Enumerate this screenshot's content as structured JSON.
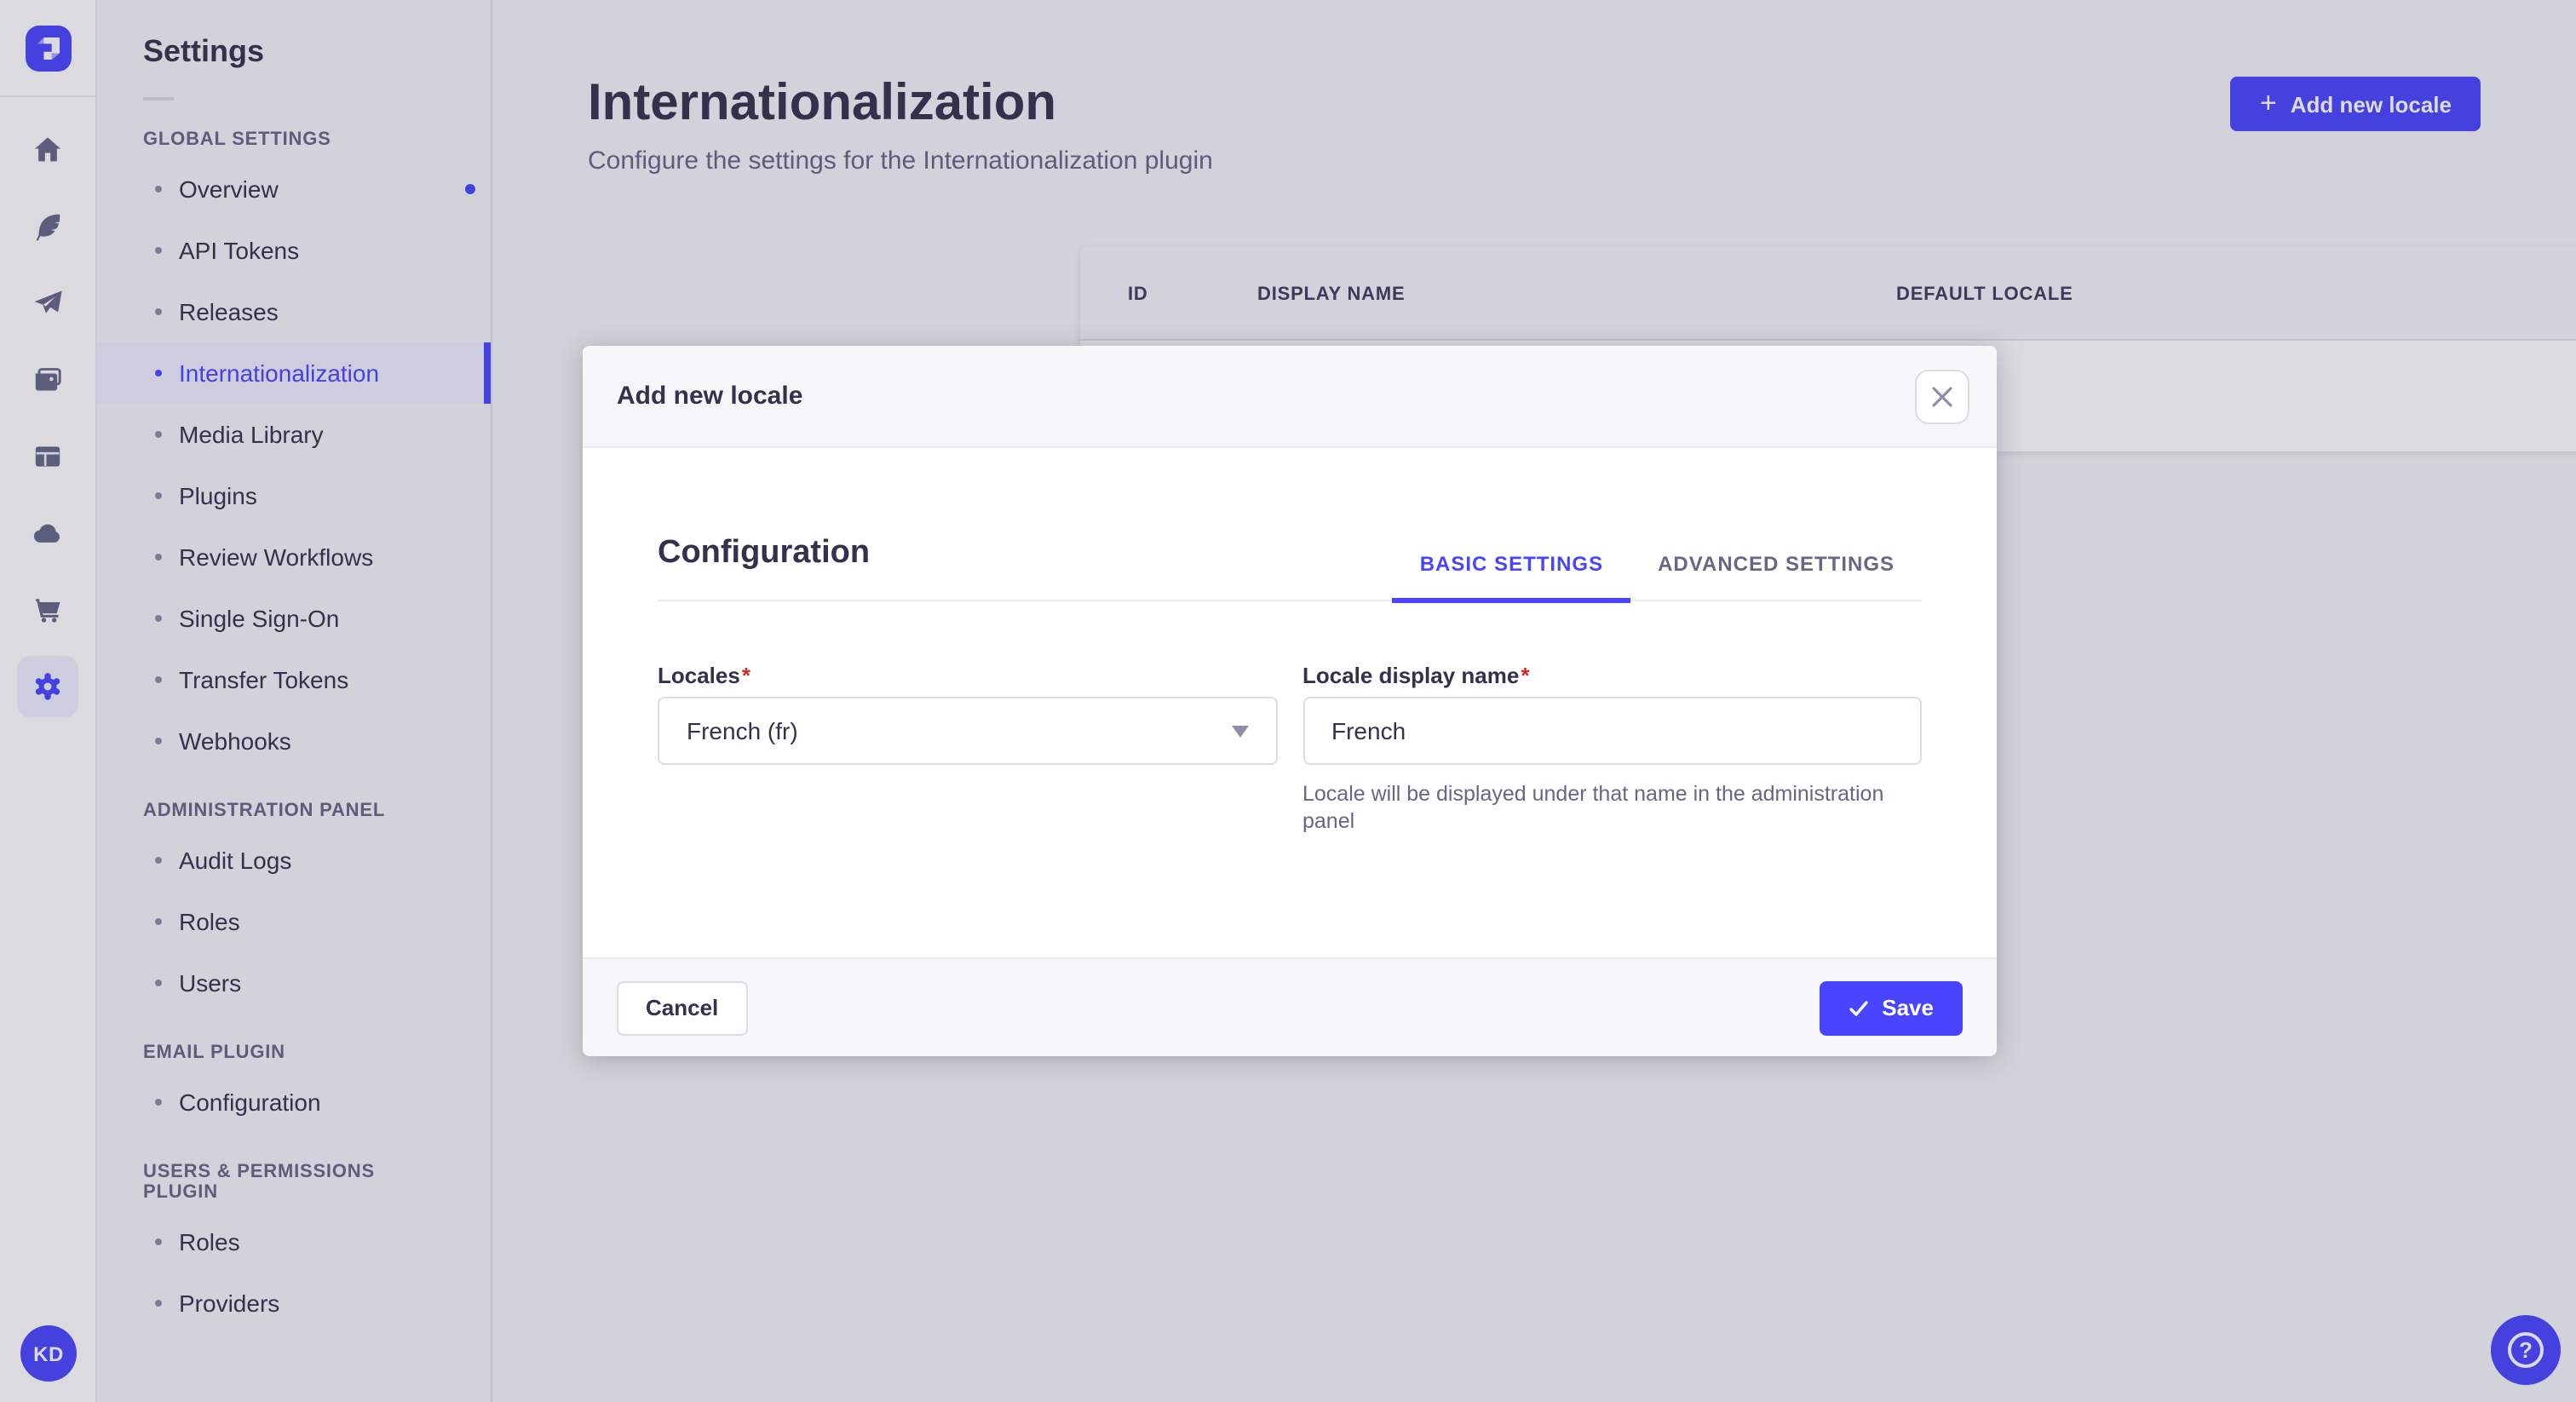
{
  "colors": {
    "accent": "#4945ff",
    "accent_soft": "#f0f0ff",
    "text_dark": "#32324d",
    "text_muted": "#666687",
    "border": "#dcdce4",
    "surface": "#ffffff",
    "surface_alt": "#f6f6f9",
    "required_red": "#d02b20"
  },
  "rail": {
    "logo_icon": "strapi-logo",
    "icons": [
      "home-icon",
      "feather-icon",
      "paper-plane-icon",
      "media-library-icon",
      "layout-icon",
      "cloud-icon",
      "cart-icon",
      "settings-gear-icon"
    ],
    "active_icon": "settings-gear-icon",
    "avatar_initials": "KD"
  },
  "sidebar": {
    "title": "Settings",
    "sections": [
      {
        "label": "GLOBAL SETTINGS",
        "items": [
          {
            "label": "Overview",
            "notification": true
          },
          {
            "label": "API Tokens"
          },
          {
            "label": "Releases"
          },
          {
            "label": "Internationalization",
            "active": true
          },
          {
            "label": "Media Library"
          },
          {
            "label": "Plugins"
          },
          {
            "label": "Review Workflows"
          },
          {
            "label": "Single Sign-On"
          },
          {
            "label": "Transfer Tokens"
          },
          {
            "label": "Webhooks"
          }
        ]
      },
      {
        "label": "ADMINISTRATION PANEL",
        "items": [
          {
            "label": "Audit Logs"
          },
          {
            "label": "Roles"
          },
          {
            "label": "Users"
          }
        ]
      },
      {
        "label": "EMAIL PLUGIN",
        "items": [
          {
            "label": "Configuration"
          }
        ]
      },
      {
        "label": "USERS & PERMISSIONS PLUGIN",
        "items": [
          {
            "label": "Roles"
          },
          {
            "label": "Providers"
          }
        ]
      }
    ]
  },
  "page": {
    "title": "Internationalization",
    "subtitle": "Configure the settings for the Internationalization plugin",
    "add_button_label": "Add new locale"
  },
  "table": {
    "columns": [
      "ID",
      "DISPLAY NAME",
      "DEFAULT LOCALE"
    ],
    "row_action_icon": "pencil-icon"
  },
  "modal": {
    "title": "Add new locale",
    "close_icon": "close-icon",
    "section_title": "Configuration",
    "tabs": [
      {
        "label": "BASIC SETTINGS",
        "active": true
      },
      {
        "label": "ADVANCED SETTINGS",
        "active": false
      }
    ],
    "locales_field": {
      "label": "Locales",
      "required": "*",
      "value": "French (fr)"
    },
    "display_name_field": {
      "label": "Locale display name",
      "required": "*",
      "value": "French",
      "hint": "Locale will be displayed under that name in the administration panel"
    },
    "cancel_label": "Cancel",
    "save_label": "Save"
  },
  "help_button": {
    "symbol": "?"
  }
}
